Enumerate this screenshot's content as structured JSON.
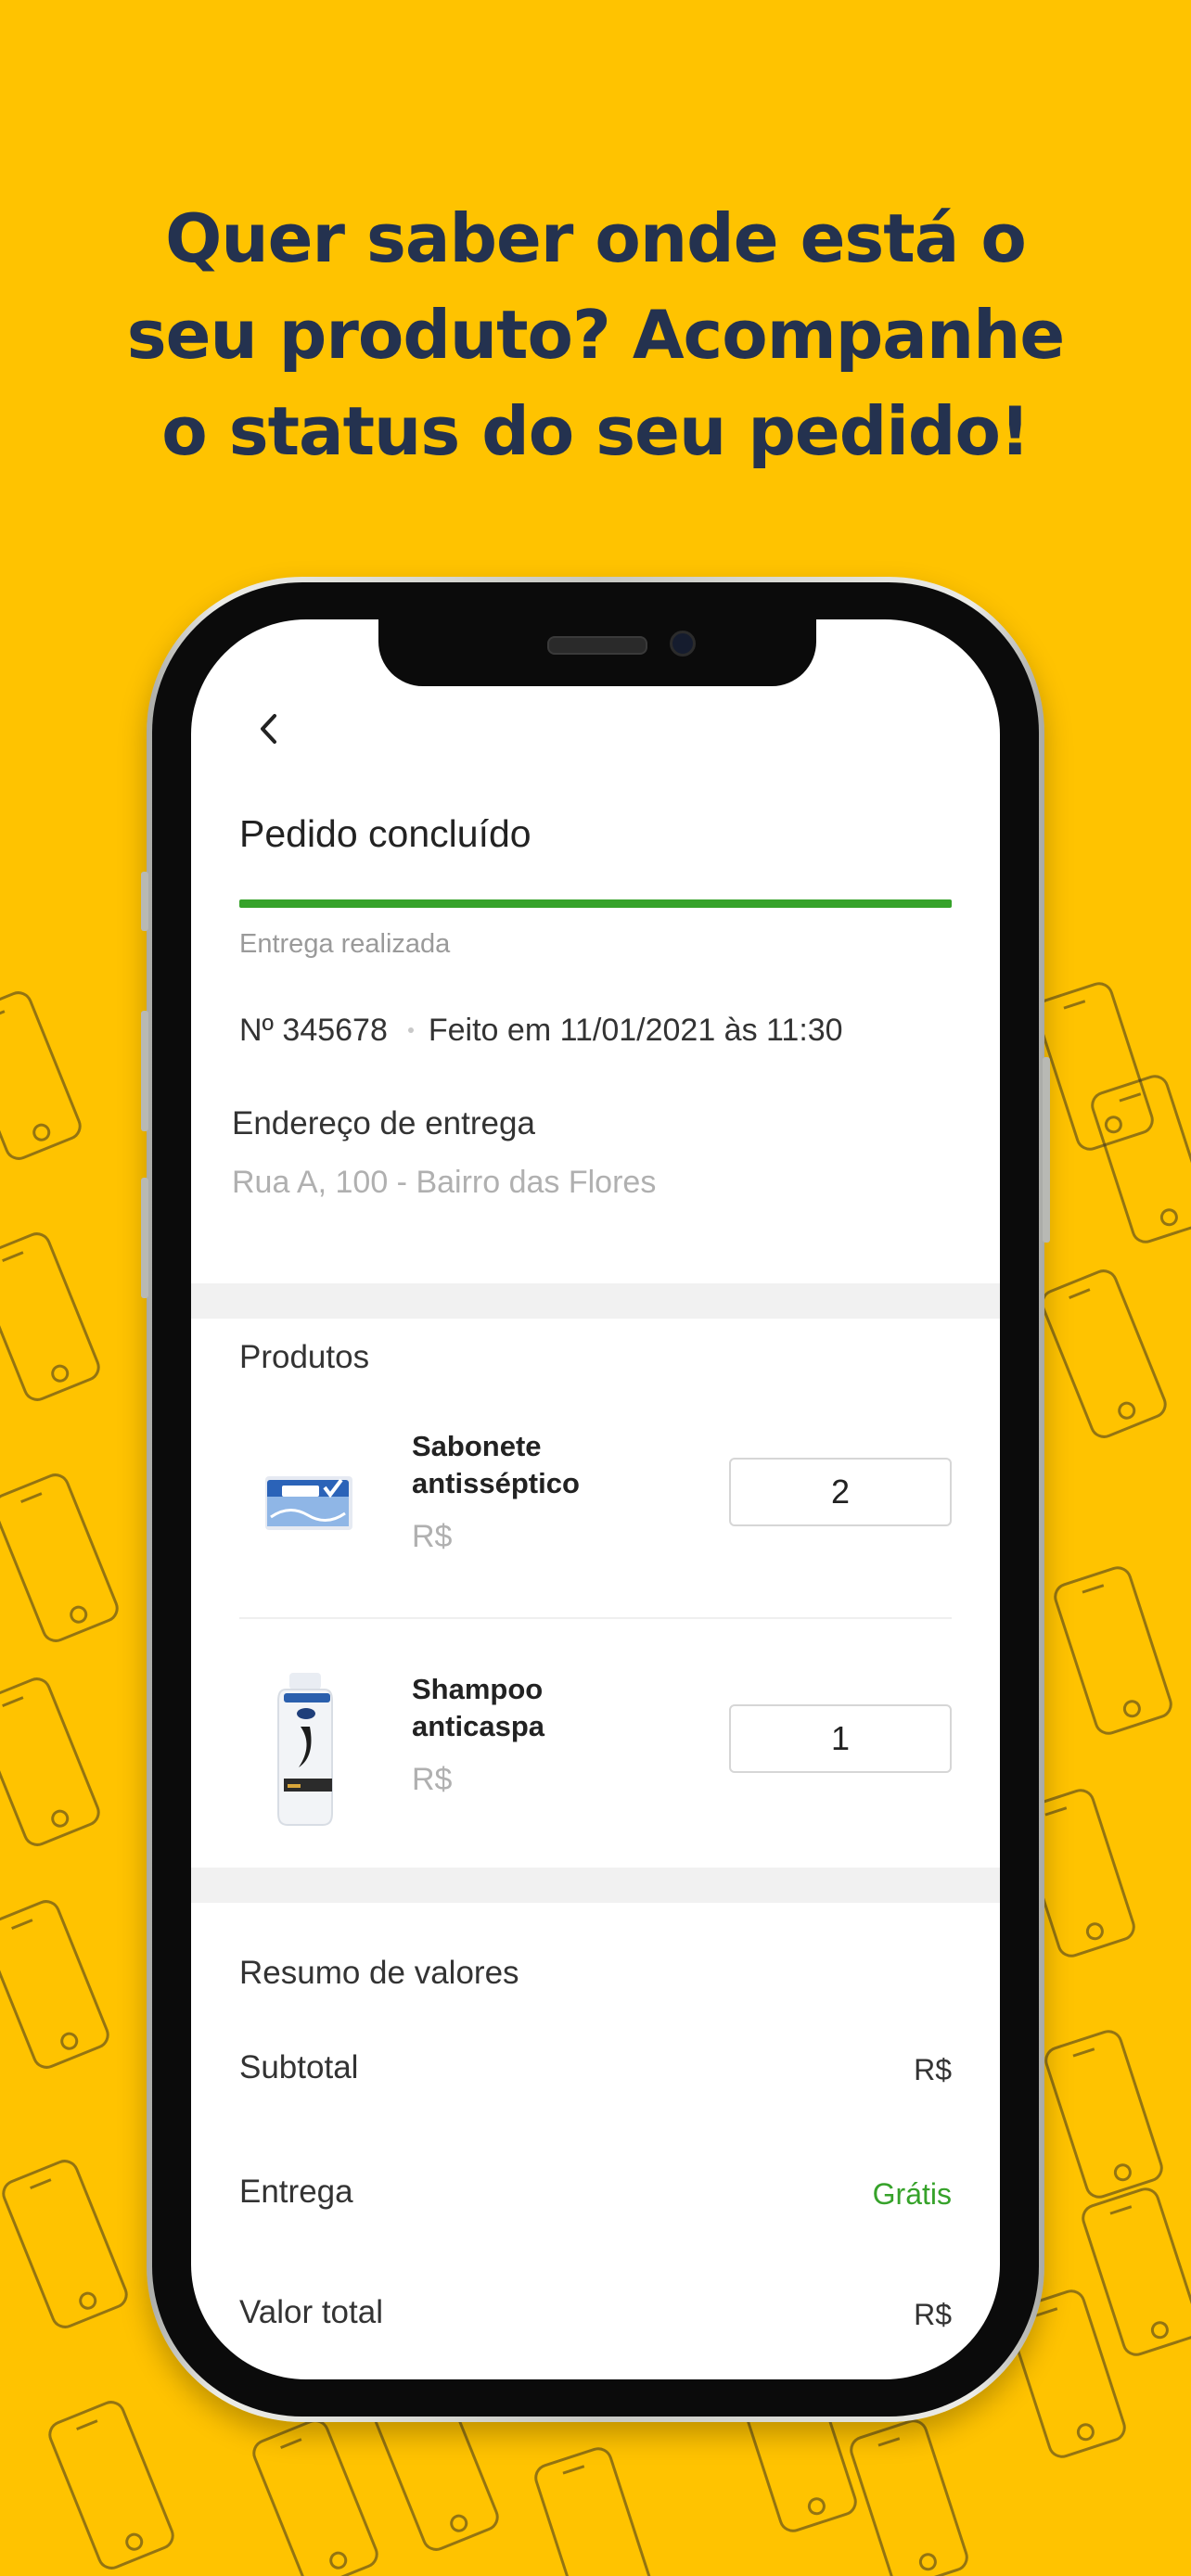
{
  "promo": {
    "headline_line1": "Quer saber onde está o",
    "headline_line2": "seu produto? Acompanhe",
    "headline_line3": "o status do seu pedido!",
    "background_color": "#FFC300",
    "text_color": "#24324F"
  },
  "header": {
    "back_icon": "chevron-left-icon",
    "title": "Pedido concluído"
  },
  "order": {
    "progress": 1,
    "status": "Entrega realizada",
    "number": "Nº 345678",
    "placed_at": "Feito em 11/01/2021 às 11:30"
  },
  "address": {
    "label": "Endereço de entrega",
    "value": "Rua A, 100 - Bairro das Flores"
  },
  "products": {
    "title": "Produtos",
    "items": [
      {
        "name_line1": "Sabonete",
        "name_line2": "antisséptico",
        "price": "R$",
        "quantity": "2",
        "image": "soap-bar"
      },
      {
        "name_line1": "Shampoo",
        "name_line2": "anticaspa",
        "price": "R$",
        "quantity": "1",
        "image": "shampoo-bottle"
      }
    ]
  },
  "summary": {
    "title": "Resumo de valores",
    "subtotal_label": "Subtotal",
    "subtotal_value": "R$",
    "delivery_label": "Entrega",
    "delivery_value": "Grátis",
    "total_label": "Valor total",
    "total_value": "R$"
  },
  "colors": {
    "accent_green": "#36A22A",
    "separator": "#F1F1F1"
  }
}
